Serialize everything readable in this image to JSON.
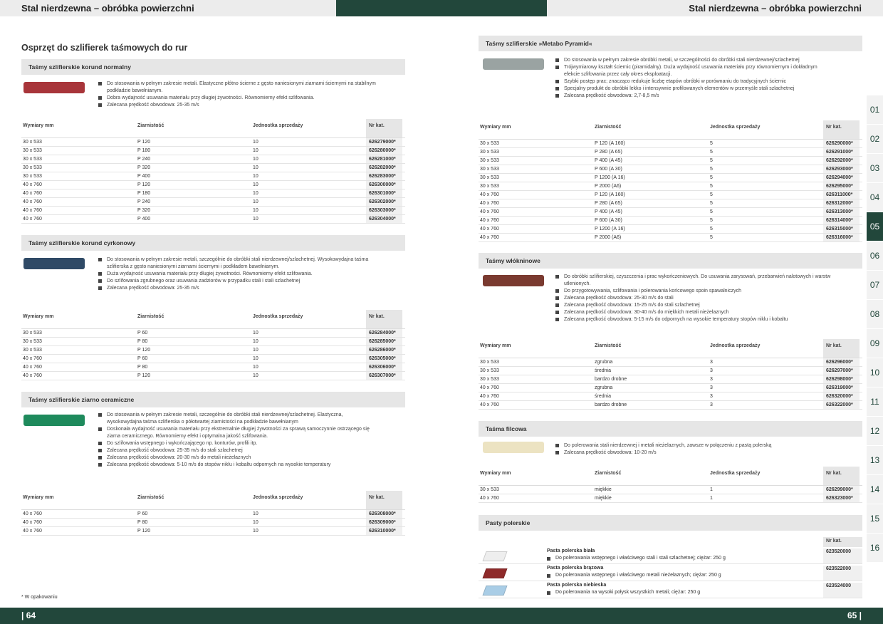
{
  "header": {
    "left_title": "Stal nierdzewna – obróbka powierzchni",
    "right_title": "Stal nierdzewna – obróbka powierzchni"
  },
  "footer": {
    "left_page": "| 64",
    "right_page": "65 |"
  },
  "left": {
    "title": "Osprzęt do szlifierek taśmowych do rur",
    "sections": [
      {
        "heading": "Taśmy szlifierskie korund normalny",
        "color": "#a8353a",
        "bullets": [
          "Do stosowania w pełnym zakresie metali. Elastyczne płótno ścierne z gęsto naniesionymi ziarnami ściernymi na stabilnym podkładzie bawełnianym.",
          "Dobra wydajność usuwania materiału przy długiej żywotności. Równomierny efekt szlifowania.",
          "Zalecana prędkość obwodowa: 25-35 m/s"
        ],
        "columns": [
          "Wymiary mm",
          "Ziarnistość",
          "Jednostka sprzedaży",
          "Nr kat."
        ],
        "rows": [
          [
            "30 x 533",
            "P 120",
            "10",
            "626279000*"
          ],
          [
            "30 x 533",
            "P 180",
            "10",
            "626280000*"
          ],
          [
            "30 x 533",
            "P 240",
            "10",
            "626281000*"
          ],
          [
            "30 x 533",
            "P 320",
            "10",
            "626282000*"
          ],
          [
            "30 x 533",
            "P 400",
            "10",
            "626283000*"
          ],
          [
            "40 x 760",
            "P 120",
            "10",
            "626300000*"
          ],
          [
            "40 x 760",
            "P 180",
            "10",
            "626301000*"
          ],
          [
            "40 x 760",
            "P 240",
            "10",
            "626302000*"
          ],
          [
            "40 x 760",
            "P 320",
            "10",
            "626303000*"
          ],
          [
            "40 x 760",
            "P 400",
            "10",
            "626304000*"
          ]
        ]
      },
      {
        "heading": "Taśmy szlifierskie korund cyrkonowy",
        "color": "#2f4a66",
        "bullets": [
          "Do stosowania w pełnym zakresie metali, szczególnie do obróbki stali nierdzewnej/szlachetnej. Wysokowydajna taśma szlifierska z gęsto naniesionymi ziarnami ściernymi i podkładem bawełnianym.",
          "Duża wydajność usuwania materiału przy długiej żywotności. Równomierny efekt szlifowania.",
          "Do szlifowania zgrubnego oraz usuwania zadziorów w przypadku stali i stali szlachetnej",
          "Zalecana prędkość obwodowa: 25-35 m/s"
        ],
        "columns": [
          "Wymiary mm",
          "Ziarnistość",
          "Jednostka sprzedaży",
          "Nr kat."
        ],
        "rows": [
          [
            "30 x 533",
            "P 60",
            "10",
            "626284000*"
          ],
          [
            "30 x 533",
            "P 80",
            "10",
            "626285000*"
          ],
          [
            "30 x 533",
            "P 120",
            "10",
            "626286000*"
          ],
          [
            "40 x 760",
            "P 60",
            "10",
            "626305000*"
          ],
          [
            "40 x 760",
            "P 80",
            "10",
            "626306000*"
          ],
          [
            "40 x 760",
            "P 120",
            "10",
            "626307000*"
          ]
        ]
      },
      {
        "heading": "Taśmy szlifierskie ziarno ceramiczne",
        "color": "#1e8a5c",
        "bullets": [
          "Do stosowania w pełnym zakresie metali, szczególnie do obróbki stali nierdzewnej/szlachetnej. Elastyczna, wysokowydajna taśma szlifierska o półotwartej ziarnistości na podkładzie bawełnianym",
          "Doskonała wydajność usuwania materiału przy ekstremalnie długiej żywotności za sprawą samoczynnie ostrzącego się ziarna ceramicznego. Równomierny efekt i optymalna jakość szlifowania.",
          "Do szlifowania wstępnego i wykończającego np. konturów, profili itp.",
          "Zalecana prędkość obwodowa: 25-35 m/s do stali szlachetnej",
          "Zalecana prędkość obwodowa: 20-30 m/s do metali nieżelaznych",
          "Zalecana prędkość obwodowa: 5-10 m/s do stopów niklu i kobaltu odpornych na wysokie temperatury"
        ],
        "columns": [
          "Wymiary mm",
          "Ziarnistość",
          "Jednostka sprzedaży",
          "Nr kat."
        ],
        "rows": [
          [
            "40 x 760",
            "P 60",
            "10",
            "626308000*"
          ],
          [
            "40 x 760",
            "P 80",
            "10",
            "626309000*"
          ],
          [
            "40 x 760",
            "P 120",
            "10",
            "626310000*"
          ]
        ]
      }
    ],
    "footnote": "* W opakowaniu"
  },
  "right": {
    "sections": [
      {
        "heading": "Taśmy szlifierskie »Metabo Pyramid«",
        "color": "#9aa3a2",
        "bullets": [
          "Do stosowania w pełnym zakresie obróbki metali, w szczególności do obróbki stali nierdzewnej/szlachetnej",
          "Trójwymiarowy kształt ścierniс (piramidalny). Duża wydajność usuwania materiału przy równomiernym i dokładnym efekcie szlifowania przez cały okres eksploatacji.",
          "Szybki postęp prac; znacząco redukuje liczbę etapów obróbki w porównaniu do tradycyjnych ściernic",
          "Specjalny produkt do obróbki lekko i intensywnie profilowanych elementów w przemyśle stali szlachetnej",
          "Zalecana prędkość obwodowa: 2,7-8,5 m/s"
        ],
        "columns": [
          "Wymiary mm",
          "Ziarnistość",
          "Jednostka sprzedaży",
          "Nr kat."
        ],
        "rows": [
          [
            "30 x 533",
            "P 120 (A 160)",
            "5",
            "626290000*"
          ],
          [
            "30 x 533",
            "P 280 (A 65)",
            "5",
            "626291000*"
          ],
          [
            "30 x 533",
            "P 400 (A 45)",
            "5",
            "626292000*"
          ],
          [
            "30 x 533",
            "P 600 (A 30)",
            "5",
            "626293000*"
          ],
          [
            "30 x 533",
            "P 1200 (A 16)",
            "5",
            "626294000*"
          ],
          [
            "30 x 533",
            "P 2000 (A6)",
            "5",
            "626295000*"
          ],
          [
            "40 x 760",
            "P 120 (A 160)",
            "5",
            "626311000*"
          ],
          [
            "40 x 760",
            "P 280 (A 65)",
            "5",
            "626312000*"
          ],
          [
            "40 x 760",
            "P 400 (A 45)",
            "5",
            "626313000*"
          ],
          [
            "40 x 760",
            "P 600 (A 30)",
            "5",
            "626314000*"
          ],
          [
            "40 x 760",
            "P 1200 (A 16)",
            "5",
            "626315000*"
          ],
          [
            "40 x 760",
            "P 2000 (A6)",
            "5",
            "626316000*"
          ]
        ]
      },
      {
        "heading": "Taśmy włókninowe",
        "color": "#7a3a30",
        "bullets": [
          "Do obróbki szlifierskiej, czyszczenia i prac wykończeniowych. Do usuwania zarysowań, przebarwień nalotowych i warstw utlenionych.",
          "Do przygotowywania, szlifowania i polerowania końcowego spoin spawalniczych",
          "Zalecana prędkość obwodowa: 25-30 m/s do stali",
          "Zalecana prędkość obwodowa: 15-25 m/s do stali szlachetnej",
          "Zalecana prędkość obwodowa: 30-40 m/s do miękkich metali nieżelaznych",
          "Zalecana prędkość obwodowa: 5-15 m/s do odpornych na wysokie temperatury stopów niklu i kobaltu"
        ],
        "columns": [
          "Wymiary mm",
          "Ziarnistość",
          "Jednostka sprzedaży",
          "Nr kat."
        ],
        "rows": [
          [
            "30 x 533",
            "zgrubna",
            "3",
            "626296000*"
          ],
          [
            "30 x 533",
            "średnia",
            "3",
            "626297000*"
          ],
          [
            "30 x 533",
            "bardzo drobne",
            "3",
            "626298000*"
          ],
          [
            "40 x 760",
            "zgrubna",
            "3",
            "626319000*"
          ],
          [
            "40 x 760",
            "średnia",
            "3",
            "626320000*"
          ],
          [
            "40 x 760",
            "bardzo drobne",
            "3",
            "626322000*"
          ]
        ]
      },
      {
        "heading": "Taśma filcowa",
        "color": "#ece3c2",
        "bullets": [
          "Do polerowania stali nierdzewnej i metali nieżelaznych, zawsze w połączeniu z pastą polerską",
          "Zalecana prędkość obwodowa: 10-20 m/s"
        ],
        "columns": [
          "Wymiary mm",
          "Ziarnistość",
          "Jednostka sprzedaży",
          "Nr kat."
        ],
        "rows": [
          [
            "30 x 533",
            "miękkie",
            "1",
            "626299000*"
          ],
          [
            "40 x 760",
            "miękkie",
            "1",
            "626323000*"
          ]
        ]
      }
    ],
    "pasty": {
      "heading": "Pasty polerskie",
      "nr_header": "Nr kat.",
      "items": [
        {
          "name": "Pasta polerska biała",
          "desc": "Do polerowania wstępnego i właściwego stali i stali szlachetnej; ciężar: 250 g",
          "nr": "623520000",
          "color": "#eeeeee"
        },
        {
          "name": "Pasta polerska brązowa",
          "desc": "Do polerowania wstępnego i właściwego metali nieżelaznych; ciężar: 250 g",
          "nr": "623522000",
          "color": "#8e2a2a"
        },
        {
          "name": "Pasta polerska niebieska",
          "desc": "Do polerowania na wysoki połysk wszystkich metali; ciężar: 250 g",
          "nr": "623524000",
          "color": "#a9cde6"
        }
      ]
    }
  },
  "tabs": {
    "items": [
      "01",
      "02",
      "03",
      "04",
      "05",
      "06",
      "07",
      "08",
      "09",
      "10",
      "11",
      "12",
      "13",
      "14",
      "15",
      "16"
    ],
    "active": "05"
  }
}
